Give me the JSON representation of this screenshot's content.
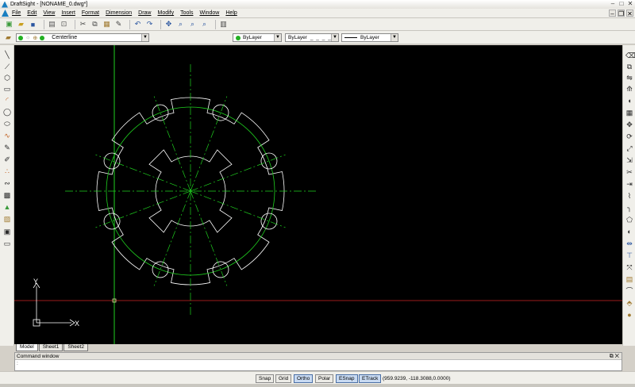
{
  "window": {
    "title": "DraftSight - [NONAME_0.dwg*]",
    "min": "–",
    "max": "□",
    "close": "✕"
  },
  "menu": [
    "File",
    "Edit",
    "View",
    "Insert",
    "Format",
    "Dimension",
    "Draw",
    "Modify",
    "Tools",
    "Window",
    "Help"
  ],
  "layer_bar": {
    "current_layer": "Centerline",
    "layer_color": "#22b022",
    "color_value": "ByLayer",
    "linetype_value": "ByLayer",
    "lineweight_value": "ByLayer"
  },
  "tabs": [
    "Model",
    "Sheet1",
    "Sheet2"
  ],
  "active_tab": "Model",
  "command_window": {
    "title": "Command window",
    "prompt": ":"
  },
  "status": {
    "buttons": [
      {
        "label": "Snap",
        "on": false
      },
      {
        "label": "Grid",
        "on": false
      },
      {
        "label": "Ortho",
        "on": true
      },
      {
        "label": "Polar",
        "on": false
      },
      {
        "label": "ESnap",
        "on": true
      },
      {
        "label": "ETrack",
        "on": true
      }
    ],
    "coordinates": "(959.9239, -118.3088,0.0000)"
  },
  "ucs_icon": {
    "x_label": "X",
    "y_label": "Y"
  },
  "colors": {
    "canvas": "#000000",
    "geometry": "#ffffff",
    "centerline": "#1fd01f",
    "axis_line": "#9b1b1b"
  }
}
